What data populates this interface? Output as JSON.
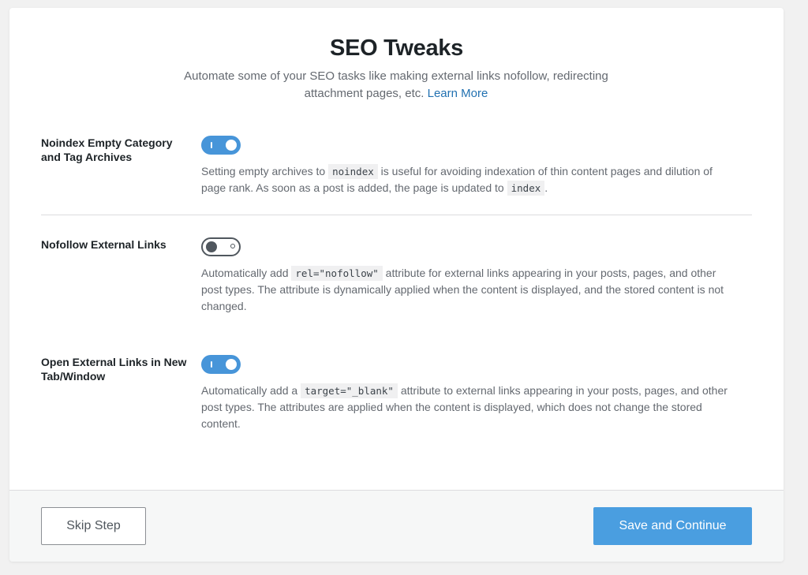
{
  "header": {
    "title": "SEO Tweaks",
    "subtitle": "Automate some of your SEO tasks like making external links nofollow, redirecting attachment pages, etc.",
    "learn_more": "Learn More"
  },
  "settings": [
    {
      "label": "Noindex Empty Category and Tag Archives",
      "enabled": true,
      "desc": {
        "t1": "Setting empty archives to",
        "c1": "noindex",
        "t2": "is useful for avoiding indexation of thin content pages and dilution of page rank. As soon as a post is added, the page is updated to",
        "c2": "index",
        "t3": "."
      }
    },
    {
      "label": "Nofollow External Links",
      "enabled": false,
      "desc": {
        "t1": "Automatically add",
        "c1": "rel=\"nofollow\"",
        "t2": "attribute for external links appearing in your posts, pages, and other post types. The attribute is dynamically applied when the content is displayed, and the stored content is not changed."
      }
    },
    {
      "label": "Open External Links in New Tab/Window",
      "enabled": true,
      "desc": {
        "t1": "Automatically add a",
        "c1": "target=\"_blank\"",
        "t2": "attribute to external links appearing in your posts, pages, and other post types. The attributes are applied when the content is displayed, which does not change the stored content."
      }
    }
  ],
  "footer": {
    "skip_label": "Skip Step",
    "save_label": "Save and Continue"
  },
  "colors": {
    "accent": "#4a9ee0",
    "toggle_on": "#4795d9",
    "link": "#2271b1"
  }
}
